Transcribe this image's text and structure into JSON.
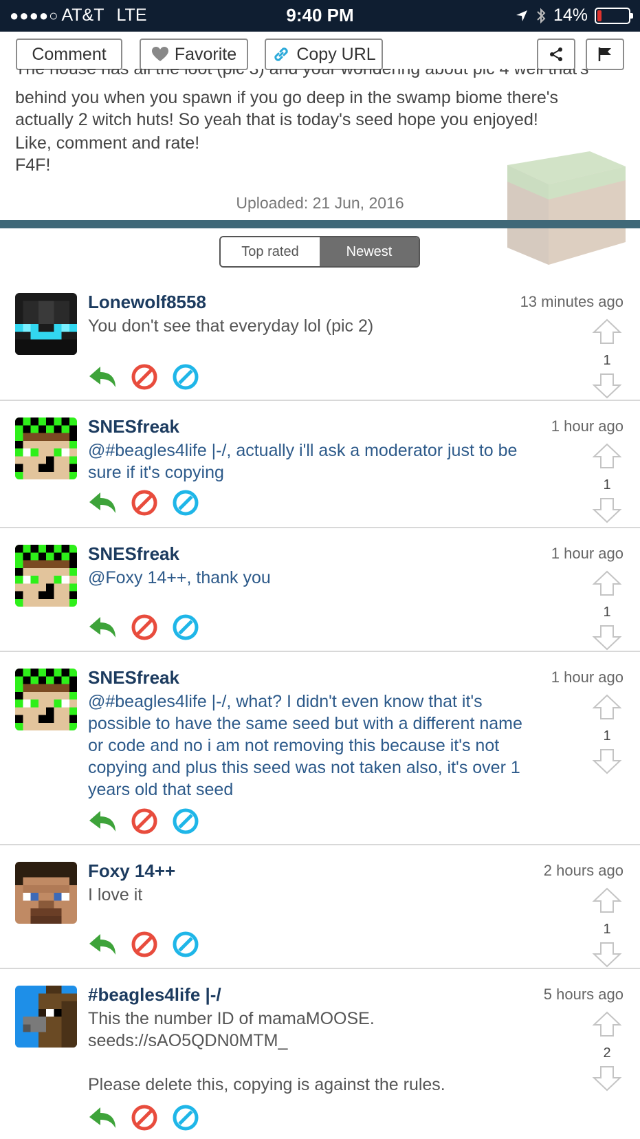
{
  "status_bar": {
    "carrier": "AT&T",
    "network": "LTE",
    "time": "9:40 PM",
    "battery": "14%",
    "battery_level": 0.14
  },
  "actions": {
    "comment": "Comment",
    "favorite": "Favorite",
    "copy_url": "Copy URL"
  },
  "description": {
    "clipped_line": "The house has all the loot (pic 3) and your wondering about pic 4 well that's",
    "lines": [
      "behind you when you spawn if you go deep in the swamp biome there's",
      "actually 2 witch huts! So yeah that is today's seed hope you enjoyed!",
      "Like, comment and rate!",
      "F4F!"
    ],
    "uploaded": "Uploaded: 21 Jun, 2016"
  },
  "sort": {
    "top_rated": "Top rated",
    "newest": "Newest",
    "selected": "Newest"
  },
  "comments": [
    {
      "user": "Lonewolf8558",
      "time": "13 minutes ago",
      "lines": [
        "You don't see that everyday lol (pic 2)"
      ],
      "votes": "1",
      "avatar": "enderman"
    },
    {
      "user": "SNESfreak",
      "time": "1 hour ago",
      "lines": [
        "@#beagles4life |-/, actually i'll ask a moderator just to be",
        "sure if it's copying"
      ],
      "votes": "1",
      "avatar": "checker"
    },
    {
      "user": "SNESfreak",
      "time": "1 hour ago",
      "lines": [
        "@Foxy 14++, thank you"
      ],
      "votes": "1",
      "avatar": "checker"
    },
    {
      "user": "SNESfreak",
      "time": "1 hour ago",
      "lines": [
        "@#beagles4life |-/, what? I didn't even know that it's",
        "possible to have the same seed but with a different name",
        "or code and no i am not removing this because it's not",
        "copying and plus this seed was not taken also, it's over 1",
        "years old that seed"
      ],
      "votes": "1",
      "avatar": "checker"
    },
    {
      "user": "Foxy 14++",
      "time": "2 hours ago",
      "lines": [
        "I love it"
      ],
      "votes": "1",
      "avatar": "steve"
    },
    {
      "user": "#beagles4life |-/",
      "time": "5 hours ago",
      "lines": [
        "This the number ID of mamaMOOSE.",
        "seeds://sAO5QDN0MTM_",
        "",
        "Please delete this, copying is against the rules."
      ],
      "votes": "2",
      "avatar": "horse"
    }
  ],
  "colors": {
    "status_bar": "#0f1e31",
    "divider": "#3f6878",
    "username": "#1c3b5f",
    "mention_text": "#2d5a8a",
    "reply_green": "#3ea33a",
    "report_red": "#e84c3d",
    "block_blue": "#1fb6e8"
  }
}
